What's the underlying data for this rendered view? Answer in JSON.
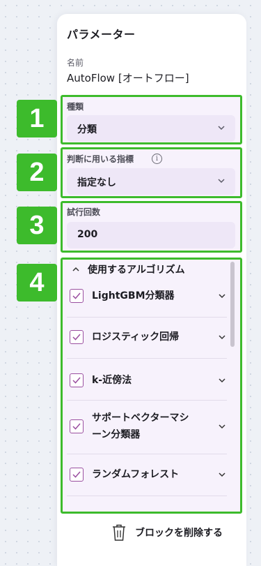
{
  "panel": {
    "title": "パラメーター",
    "name_label": "名前",
    "name_value": "AutoFlow [オートフロー]"
  },
  "fields": {
    "type": {
      "label": "種類",
      "value": "分類"
    },
    "metric": {
      "label": "判断に用いる指標",
      "value": "指定なし",
      "info_icon": "info-icon"
    },
    "trials": {
      "label": "試行回数",
      "value": "200"
    }
  },
  "badges": [
    "1",
    "2",
    "3",
    "4"
  ],
  "algorithms": {
    "header": "使用するアルゴリズム",
    "items": [
      {
        "label": "LightGBM分類器",
        "checked": true
      },
      {
        "label": "ロジスティック回帰",
        "checked": true
      },
      {
        "label": "k-近傍法",
        "checked": true
      },
      {
        "label_line1": "サポートベクターマシ",
        "label_line2": "ーン分類器",
        "checked": true
      },
      {
        "label": "ランダムフォレスト",
        "checked": true
      }
    ]
  },
  "actions": {
    "delete_label": "ブロックを削除する"
  },
  "colors": {
    "highlight": "#3dbb2c",
    "checkbox": "#9a4fa0",
    "field_bg": "#eee7f7"
  }
}
